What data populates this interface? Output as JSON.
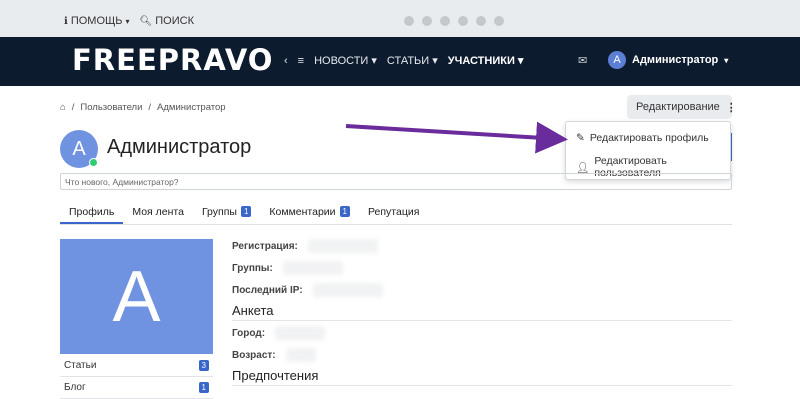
{
  "topbar": {
    "help": "ПОМОЩЬ",
    "search": "ПОИСК"
  },
  "navbar": {
    "logo": "FREEPRAVO",
    "links": [
      "НОВОСТИ",
      "СТАТЬИ",
      "УЧАСТНИКИ"
    ],
    "user_name": "Администратор",
    "user_initial": "A"
  },
  "breadcrumb": {
    "items": [
      "Пользователи",
      "Администратор"
    ]
  },
  "edit": {
    "button": "Редактирование",
    "menu": [
      "Редактировать профиль",
      "Редактировать пользователя"
    ]
  },
  "profile": {
    "name": "Администратор",
    "initial": "A",
    "status_placeholder": "Что нового, Администратор?",
    "tabs": [
      {
        "label": "Профиль",
        "badge": ""
      },
      {
        "label": "Моя лента",
        "badge": ""
      },
      {
        "label": "Группы",
        "badge": "1"
      },
      {
        "label": "Комментарии",
        "badge": "1"
      },
      {
        "label": "Репутация",
        "badge": ""
      }
    ],
    "stats": [
      {
        "label": "Статьи",
        "count": "3"
      },
      {
        "label": "Блог",
        "count": "1"
      }
    ],
    "fields": [
      "Регистрация:",
      "Группы:",
      "Последний IP:"
    ],
    "sections": [
      "Анкета",
      "Предпочтения"
    ],
    "anketa_fields": [
      "Город:",
      "Возраст:"
    ]
  },
  "colors": {
    "navbar": "#0d1b2e",
    "accent": "#3a66c9",
    "avatar": "#6f93e0",
    "arrow": "#6a2b9c"
  }
}
